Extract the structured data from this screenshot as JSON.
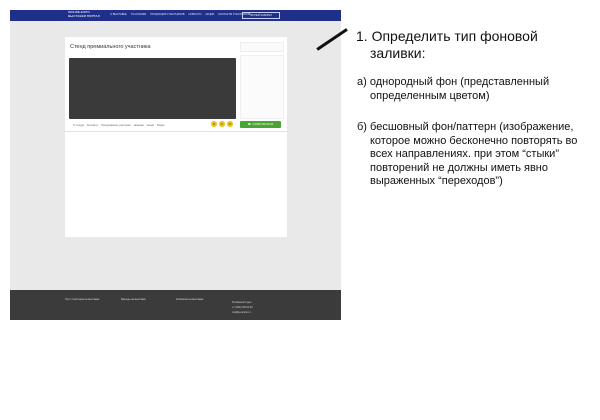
{
  "screenshot": {
    "logo_lines": [
      "ONLINE-EXPO",
      "ВЫСТАВКИ ПОРТАЛ"
    ],
    "nav_items": [
      "О ВЫСТАВКЕ",
      "УЧАСТНИКИ",
      "ПРОДУКЦИЯ УЧАСТНИКОВ",
      "НОВОСТИ",
      "АКЦИИ",
      "КОНТАКТЫ УЧАСТНИКОВ"
    ],
    "top_button": "ЛИЧНЫЙ КАБИНЕТ",
    "stand_title": "Стенд премиального участника",
    "tabs": [
      "О стенде",
      "Контакты",
      "Предложения участника",
      "Новинки",
      "Акции",
      "Видео"
    ],
    "phone_button": "+7(000) 000-00-00",
    "footer_links": [
      "Путь Участника на выставке",
      "Бренды на выставке",
      "Компании на выставке"
    ],
    "footer_contacts": [
      "Рекламный отдел",
      "+7 (000) 000-00-00",
      "mail@example.ru"
    ]
  },
  "annotation": {
    "heading_line1": "1. Определить тип фоновой",
    "heading_line2": "заливки:",
    "option_a": "а) однородный фон (представленный определенным цветом)",
    "option_b": "б) бесшовный фон/паттерн (изображение, которое можно бесконечно повторять во всех направлениях. при этом “стыки” повторений не должны иметь явно выраженных “переходов”)"
  },
  "colors": {
    "header_bg": "#1f2f8a",
    "footer_bg": "#3b3b3b",
    "page_bg": "#e9e9e9",
    "video_bg": "#3a3a3a",
    "accent_green": "#4aa633",
    "icon_yellow": "#e9c21b"
  }
}
